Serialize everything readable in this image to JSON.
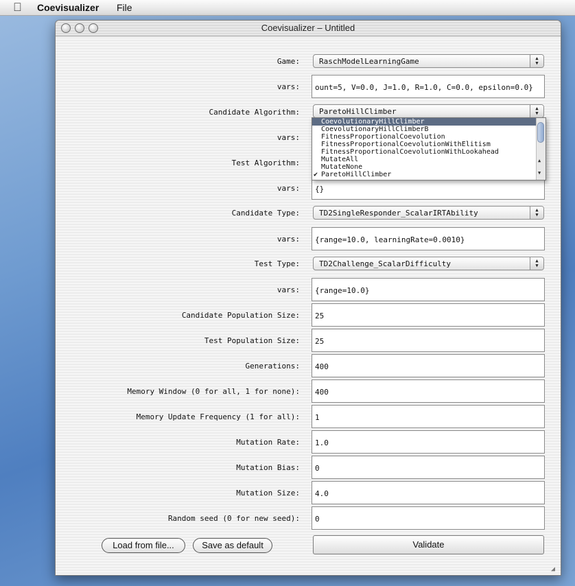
{
  "menubar": {
    "apple_icon": "apple-logo-icon",
    "app_name": "Coevisualizer",
    "file_menu": "File"
  },
  "window": {
    "title": "Coevisualizer – Untitled"
  },
  "form": {
    "game": {
      "label": "Game:",
      "value": "RaschModelLearningGame"
    },
    "game_vars": {
      "label": "vars:",
      "value": "ount=5, V=0.0, J=1.0, R=1.0, C=0.0, epsilon=0.0}"
    },
    "candidate_algorithm": {
      "label": "Candidate Algorithm:",
      "value": "ParetoHillClimber"
    },
    "candidate_algorithm_vars": {
      "label": "vars:"
    },
    "test_algorithm": {
      "label": "Test Algorithm:"
    },
    "test_algorithm_vars": {
      "label": "vars:",
      "value": "{}"
    },
    "candidate_type": {
      "label": "Candidate Type:",
      "value": "TD2SingleResponder_ScalarIRTAbility"
    },
    "candidate_type_vars": {
      "label": "vars:",
      "value": "{range=10.0, learningRate=0.0010}"
    },
    "test_type": {
      "label": "Test Type:",
      "value": "TD2Challenge_ScalarDifficulty"
    },
    "test_type_vars": {
      "label": "vars:",
      "value": "{range=10.0}"
    },
    "candidate_population_size": {
      "label": "Candidate Population Size:",
      "value": "25"
    },
    "test_population_size": {
      "label": "Test Population Size:",
      "value": "25"
    },
    "generations": {
      "label": "Generations:",
      "value": "400"
    },
    "memory_window": {
      "label": "Memory Window (0 for all, 1 for none):",
      "value": "400"
    },
    "memory_update_frequency": {
      "label": "Memory Update Frequency (1 for all):",
      "value": "1"
    },
    "mutation_rate": {
      "label": "Mutation Rate:",
      "value": "1.0"
    },
    "mutation_bias": {
      "label": "Mutation Bias:",
      "value": "0"
    },
    "mutation_size": {
      "label": "Mutation Size:",
      "value": "4.0"
    },
    "random_seed": {
      "label": "Random seed (0 for new seed):",
      "value": "0"
    }
  },
  "dropdown": {
    "items": [
      "CoevolutionaryHillClimber",
      "CoevolutionaryHillClimberB",
      "FitnessProportionalCoevolution",
      "FitnessProportionalCoevolutionWithElitism",
      "FitnessProportionalCoevolutionWithLookahead",
      "MutateAll",
      "MutateNone",
      "ParetoHillClimber"
    ],
    "highlighted_index": 0,
    "checked_index": 7,
    "checkmark": "✔"
  },
  "buttons": {
    "load": "Load from file...",
    "save_default": "Save as default",
    "validate": "Validate"
  }
}
